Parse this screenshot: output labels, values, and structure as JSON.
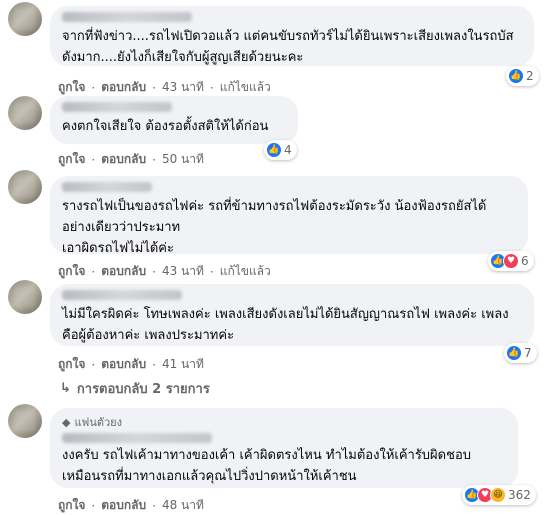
{
  "comments": [
    {
      "text": "จากที่ฟังข่าว....รถไฟเปิดวอแล้ว แต่คนขับรถทัวร์ไม่ได้ยินเพราะเสียงเพลงในรถบัสดังมาก....ยังไงก็เสียใจกับผู้สูญเสียด้วยนะคะ",
      "like": "ถูกใจ",
      "reply": "ตอบกลับ",
      "time": "43 นาที",
      "edited": "แก้ไขแล้ว",
      "react_count": "2",
      "reactions": [
        "like"
      ]
    },
    {
      "text": "คงตกใจเสียใจ ต้องรอตั้งสติให้ได้ก่อน",
      "like": "ถูกใจ",
      "reply": "ตอบกลับ",
      "time": "50 นาที",
      "react_count": "4",
      "reactions": [
        "like"
      ]
    },
    {
      "text": "รางรถไฟเป็นของรถไฟค่ะ รถที่ข้ามทางรถไฟต้องระมัดระวัง น้องฟ้องรถยัสได้ อย่างเดียวว่าประมาท\nเอาผิดรถไฟไม่ได้ค่ะ",
      "like": "ถูกใจ",
      "reply": "ตอบกลับ",
      "time": "43 นาที",
      "edited": "แก้ไขแล้ว",
      "react_count": "6",
      "reactions": [
        "like",
        "love"
      ]
    },
    {
      "text": "ไม่มีใครผิดค่ะ โทษเพลงค่ะ เพลงเสียงดังเลยไม่ได้ยินสัญญาณรถไฟ เพลงค่ะ เพลงคือผู้ต้องหาค่ะ เพลงประมาทค่ะ",
      "like": "ถูกใจ",
      "reply": "ตอบกลับ",
      "time": "41 นาที",
      "react_count": "7",
      "reactions": [
        "like"
      ]
    },
    {
      "badge": "แฟนตัวยง",
      "text": "งงครับ รถไฟเค้ามาทางของเค้า เค้าผิดตรงไหน ทำไมต้องให้เค้ารับผิดชอบ เหมือนรถที่มาทางเอกแล้วคุณไปวิ่งปาดหน้าให้เค้าชน",
      "like": "ถูกใจ",
      "reply": "ตอบกลับ",
      "time": "48 นาที",
      "react_count": "362",
      "reactions": [
        "like",
        "love",
        "haha"
      ]
    }
  ],
  "view_replies": "การตอบกลับ 2 รายการ",
  "colors": {
    "bubble": "#f0f2f5",
    "meta": "#65676b",
    "like": "#1877f2",
    "love": "#f33e58",
    "haha": "#f7b928"
  }
}
